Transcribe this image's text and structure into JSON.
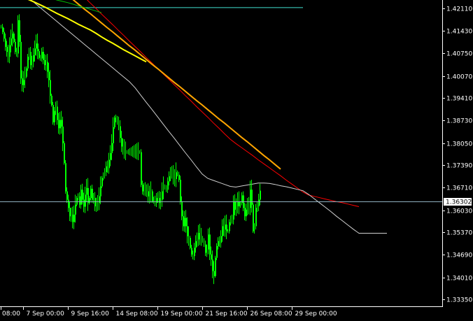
{
  "chart_data": {
    "type": "candlestick",
    "instrument": "",
    "timeframe": "",
    "grid": false,
    "background": "#000000",
    "candle_color": "#00ff00",
    "y_axis": {
      "ylim": [
        1.3314,
        1.4236
      ],
      "tick_labels": [
        "1.42110",
        "1.41430",
        "1.40750",
        "1.40070",
        "1.39410",
        "1.38730",
        "1.38050",
        "1.37390",
        "1.36710",
        "1.36030",
        "1.35370",
        "1.34690",
        "1.34010",
        "1.33350"
      ]
    },
    "x_axis": {
      "tick_labels": [
        "08:00",
        "7 Sep 00:00",
        "9 Sep 16:00",
        "14 Sep 08:00",
        "19 Sep 00:00",
        "21 Sep 16:00",
        "26 Sep 08:00",
        "29 Sep 00:00"
      ],
      "tick_positions_bar_index": [
        0,
        16,
        48,
        80,
        112,
        144,
        176,
        208
      ]
    },
    "current_price": "1.36302",
    "current_price_value": 1.36302,
    "horizontal_levels": [
      {
        "value": 1.4213,
        "color": "#40e0d0"
      }
    ],
    "closes": [
      1.4155,
      1.414,
      1.412,
      1.4095,
      1.408,
      1.4065,
      1.41,
      1.412,
      1.4135,
      1.411,
      1.408,
      1.4075,
      1.4175,
      1.411,
      1.4,
      1.398,
      1.3995,
      1.4005,
      1.403,
      1.4065,
      1.408,
      1.404,
      1.405,
      1.407,
      1.409,
      1.4105,
      1.4082,
      1.4062,
      1.406,
      1.408,
      1.4055,
      1.404,
      1.405,
      1.402,
      1.3995,
      1.3948,
      1.392,
      1.3868,
      1.3902,
      1.3915,
      1.3875,
      1.385,
      1.3875,
      1.3855,
      1.3805,
      1.3745,
      1.366,
      1.3635,
      1.361,
      1.3585,
      1.359,
      1.3568,
      1.359,
      1.362,
      1.364,
      1.3645,
      1.362,
      1.3665,
      1.3635,
      1.3614,
      1.365,
      1.367,
      1.3625,
      1.364,
      1.3668,
      1.3635,
      1.364,
      1.3615,
      1.362,
      1.3625,
      1.3645,
      1.3675,
      1.37,
      1.3708,
      1.3718,
      1.3735,
      1.373,
      1.3755,
      1.3775,
      1.3805,
      1.3853,
      1.3882,
      1.3875,
      1.387,
      1.3856,
      1.3821,
      1.3795,
      1.379,
      1.378,
      1.3778,
      1.3778,
      1.3778,
      1.3778,
      1.3778,
      1.3778,
      1.3778,
      1.3778,
      1.3778,
      1.3778,
      1.3778,
      1.368,
      1.366,
      1.367,
      1.366,
      1.366,
      1.3645,
      1.365,
      1.366,
      1.363,
      1.3635,
      1.3625,
      1.364,
      1.364,
      1.3625,
      1.3635,
      1.366,
      1.3675,
      1.367,
      1.3665,
      1.369,
      1.3705,
      1.3715,
      1.3715,
      1.37,
      1.3697,
      1.3717,
      1.371,
      1.3695,
      1.363,
      1.3585,
      1.3555,
      1.358,
      1.3555,
      1.3525,
      1.352,
      1.349,
      1.347,
      1.3465,
      1.349,
      1.351,
      1.3515,
      1.3535,
      1.352,
      1.352,
      1.351,
      1.35,
      1.3475,
      1.3485,
      1.353,
      1.347,
      1.3455,
      1.342,
      1.3405,
      1.346,
      1.3495,
      1.351,
      1.3505,
      1.3525,
      1.3555,
      1.3545,
      1.356,
      1.354,
      1.354,
      1.3567,
      1.3575,
      1.3575,
      1.363,
      1.3605,
      1.3615,
      1.363,
      1.3615,
      1.3625,
      1.3648,
      1.361,
      1.3585,
      1.3605,
      1.3619,
      1.361,
      1.3665,
      1.362,
      1.354,
      1.3555,
      1.361,
      1.3615,
      1.3635,
      1.3662
    ],
    "moving_averages": [
      {
        "color": "#ff0000",
        "values": [
          1.449,
          1.4474,
          1.4457,
          1.4441,
          1.4424,
          1.4408,
          1.4392,
          1.4375,
          1.4359,
          1.4342,
          1.4326,
          1.4309,
          1.4293,
          1.4277,
          1.426,
          1.4244,
          1.4227,
          1.4211,
          1.4194,
          1.4178,
          1.4162,
          1.4145,
          1.4129,
          1.4112,
          1.4096,
          1.408,
          1.4063,
          1.4047,
          1.403,
          1.4014,
          1.3998,
          1.3981,
          1.3965,
          1.3948,
          1.3932,
          1.3915,
          1.3899,
          1.3883,
          1.3866,
          1.385,
          1.3833,
          1.3817,
          1.3804,
          1.3792,
          1.378,
          1.3768,
          1.3755,
          1.3743,
          1.3731,
          1.3719,
          1.3707,
          1.3694,
          1.3682,
          1.367,
          1.3658,
          1.3649,
          1.3645,
          1.3641,
          1.3637,
          1.3633,
          1.3629,
          1.3626,
          1.3622,
          1.3618,
          1.3614
        ]
      },
      {
        "color": "#d0d0d0",
        "values": [
          1.4293,
          1.4283,
          1.4273,
          1.4262,
          1.4252,
          1.4242,
          1.4228,
          1.4214,
          1.42,
          1.4186,
          1.4172,
          1.4158,
          1.4144,
          1.413,
          1.4116,
          1.4102,
          1.4088,
          1.4074,
          1.406,
          1.4046,
          1.4032,
          1.4018,
          1.4004,
          1.399,
          1.3972,
          1.395,
          1.3928,
          1.3907,
          1.3885,
          1.3863,
          1.3841,
          1.382,
          1.3798,
          1.3776,
          1.3755,
          1.3733,
          1.3712,
          1.3699,
          1.3693,
          1.3687,
          1.3681,
          1.3675,
          1.3673,
          1.3676,
          1.3679,
          1.3682,
          1.3685,
          1.3685,
          1.3684,
          1.3681,
          1.3677,
          1.3674,
          1.367,
          1.3666,
          1.3662,
          1.3651,
          1.3638,
          1.3625,
          1.3612,
          1.3599,
          1.3585,
          1.3572,
          1.3559,
          1.3546,
          1.3534,
          1.3534,
          1.3534,
          1.3534,
          1.3534,
          1.3534
        ]
      },
      {
        "color": "#ffa500",
        "values": [
          1.4415,
          1.4401,
          1.4387,
          1.4373,
          1.436,
          1.4346,
          1.4332,
          1.4318,
          1.4305,
          1.4291,
          1.4277,
          1.4263,
          1.425,
          1.4236,
          1.4222,
          1.4208,
          1.4195,
          1.4181,
          1.4167,
          1.4153,
          1.414,
          1.4126,
          1.4112,
          1.4098,
          1.4085,
          1.4071,
          1.4057,
          1.4043,
          1.403,
          1.4016,
          1.4002,
          1.3988,
          1.3975,
          1.3961,
          1.3947,
          1.3933,
          1.392,
          1.3906,
          1.3892,
          1.3878,
          1.3865,
          1.3851,
          1.3837,
          1.3823,
          1.381,
          1.3796,
          1.3782,
          1.3768,
          1.3755,
          1.3741,
          1.3727
        ]
      },
      {
        "color": "#ffff00",
        "values": [
          1.4267,
          1.4263,
          1.4257,
          1.4251,
          1.4244,
          1.4237,
          1.423,
          1.4222,
          1.4214,
          1.4205,
          1.4196,
          1.4188,
          1.418,
          1.4171,
          1.4162,
          1.4154,
          1.4146,
          1.4136,
          1.4125,
          1.4115,
          1.4106,
          1.4096,
          1.4086,
          1.4077,
          1.4068,
          1.4059,
          1.405
        ]
      },
      {
        "color": "#00c000",
        "values": [
          1.4277,
          1.4275,
          1.4272,
          1.4268,
          1.4264,
          1.426,
          1.4256,
          1.4251,
          1.4246,
          1.4241,
          1.4236,
          1.4232,
          1.4228,
          1.4223,
          1.4218,
          1.4213,
          1.4208,
          1.4203,
          1.4198
        ]
      }
    ]
  }
}
